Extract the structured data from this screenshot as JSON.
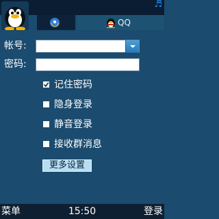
{
  "status_bar": {
    "icon": "music-note-icon"
  },
  "tabs": [
    {
      "icon": "browser-globe-icon",
      "label": ""
    },
    {
      "icon": "qq-penguin-icon",
      "label": "QQ"
    }
  ],
  "login_form": {
    "account_label": "帐号:",
    "account_value": "",
    "password_label": "密码:",
    "password_value": "",
    "options": [
      {
        "label": "记住密码",
        "checked": true
      },
      {
        "label": "隐身登录",
        "checked": false
      },
      {
        "label": "静音登录",
        "checked": false
      },
      {
        "label": "接收群消息",
        "checked": false
      }
    ],
    "more_settings_label": "更多设置"
  },
  "softkeys": {
    "left": "菜单",
    "center_time": "15:50",
    "right": "登录"
  },
  "colors": {
    "background": "#1b4b6e",
    "top_bar": "#0a1d33",
    "accent_blue": "#2a78b6",
    "button_bg": "#b6ddf2"
  }
}
